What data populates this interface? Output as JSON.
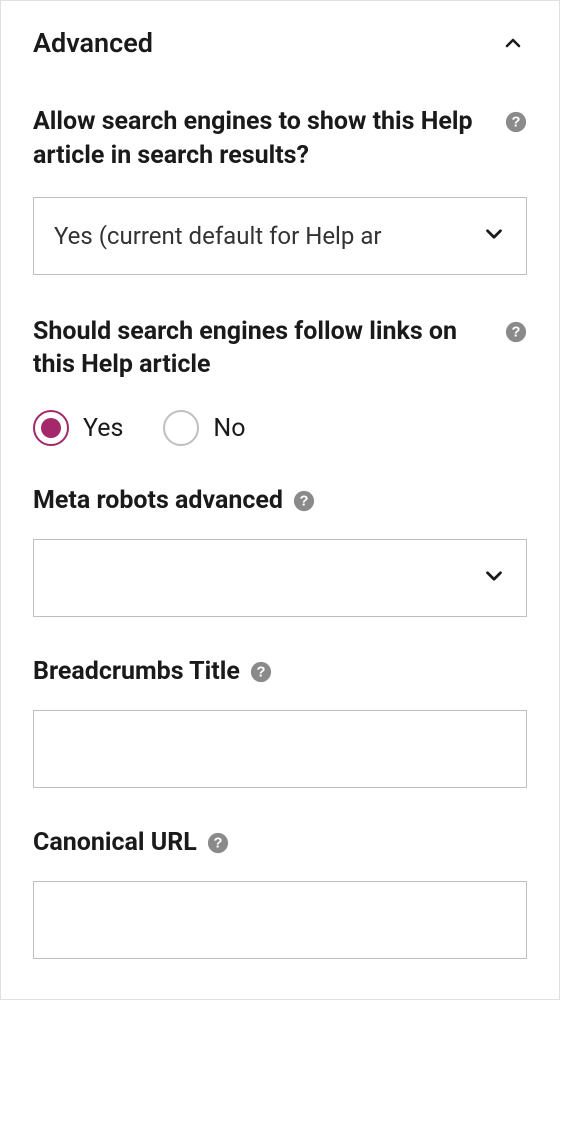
{
  "panel": {
    "title": "Advanced"
  },
  "fields": {
    "allow_search": {
      "label": "Allow search engines to show this Help article in search results?",
      "selected": "Yes (current default for Help ar"
    },
    "follow_links": {
      "label": "Should search engines follow links on this Help article",
      "options": {
        "yes": "Yes",
        "no": "No"
      },
      "selected": "yes"
    },
    "meta_robots": {
      "label": "Meta robots advanced",
      "selected": ""
    },
    "breadcrumbs": {
      "label": "Breadcrumbs Title",
      "value": ""
    },
    "canonical": {
      "label": "Canonical URL",
      "value": ""
    }
  }
}
